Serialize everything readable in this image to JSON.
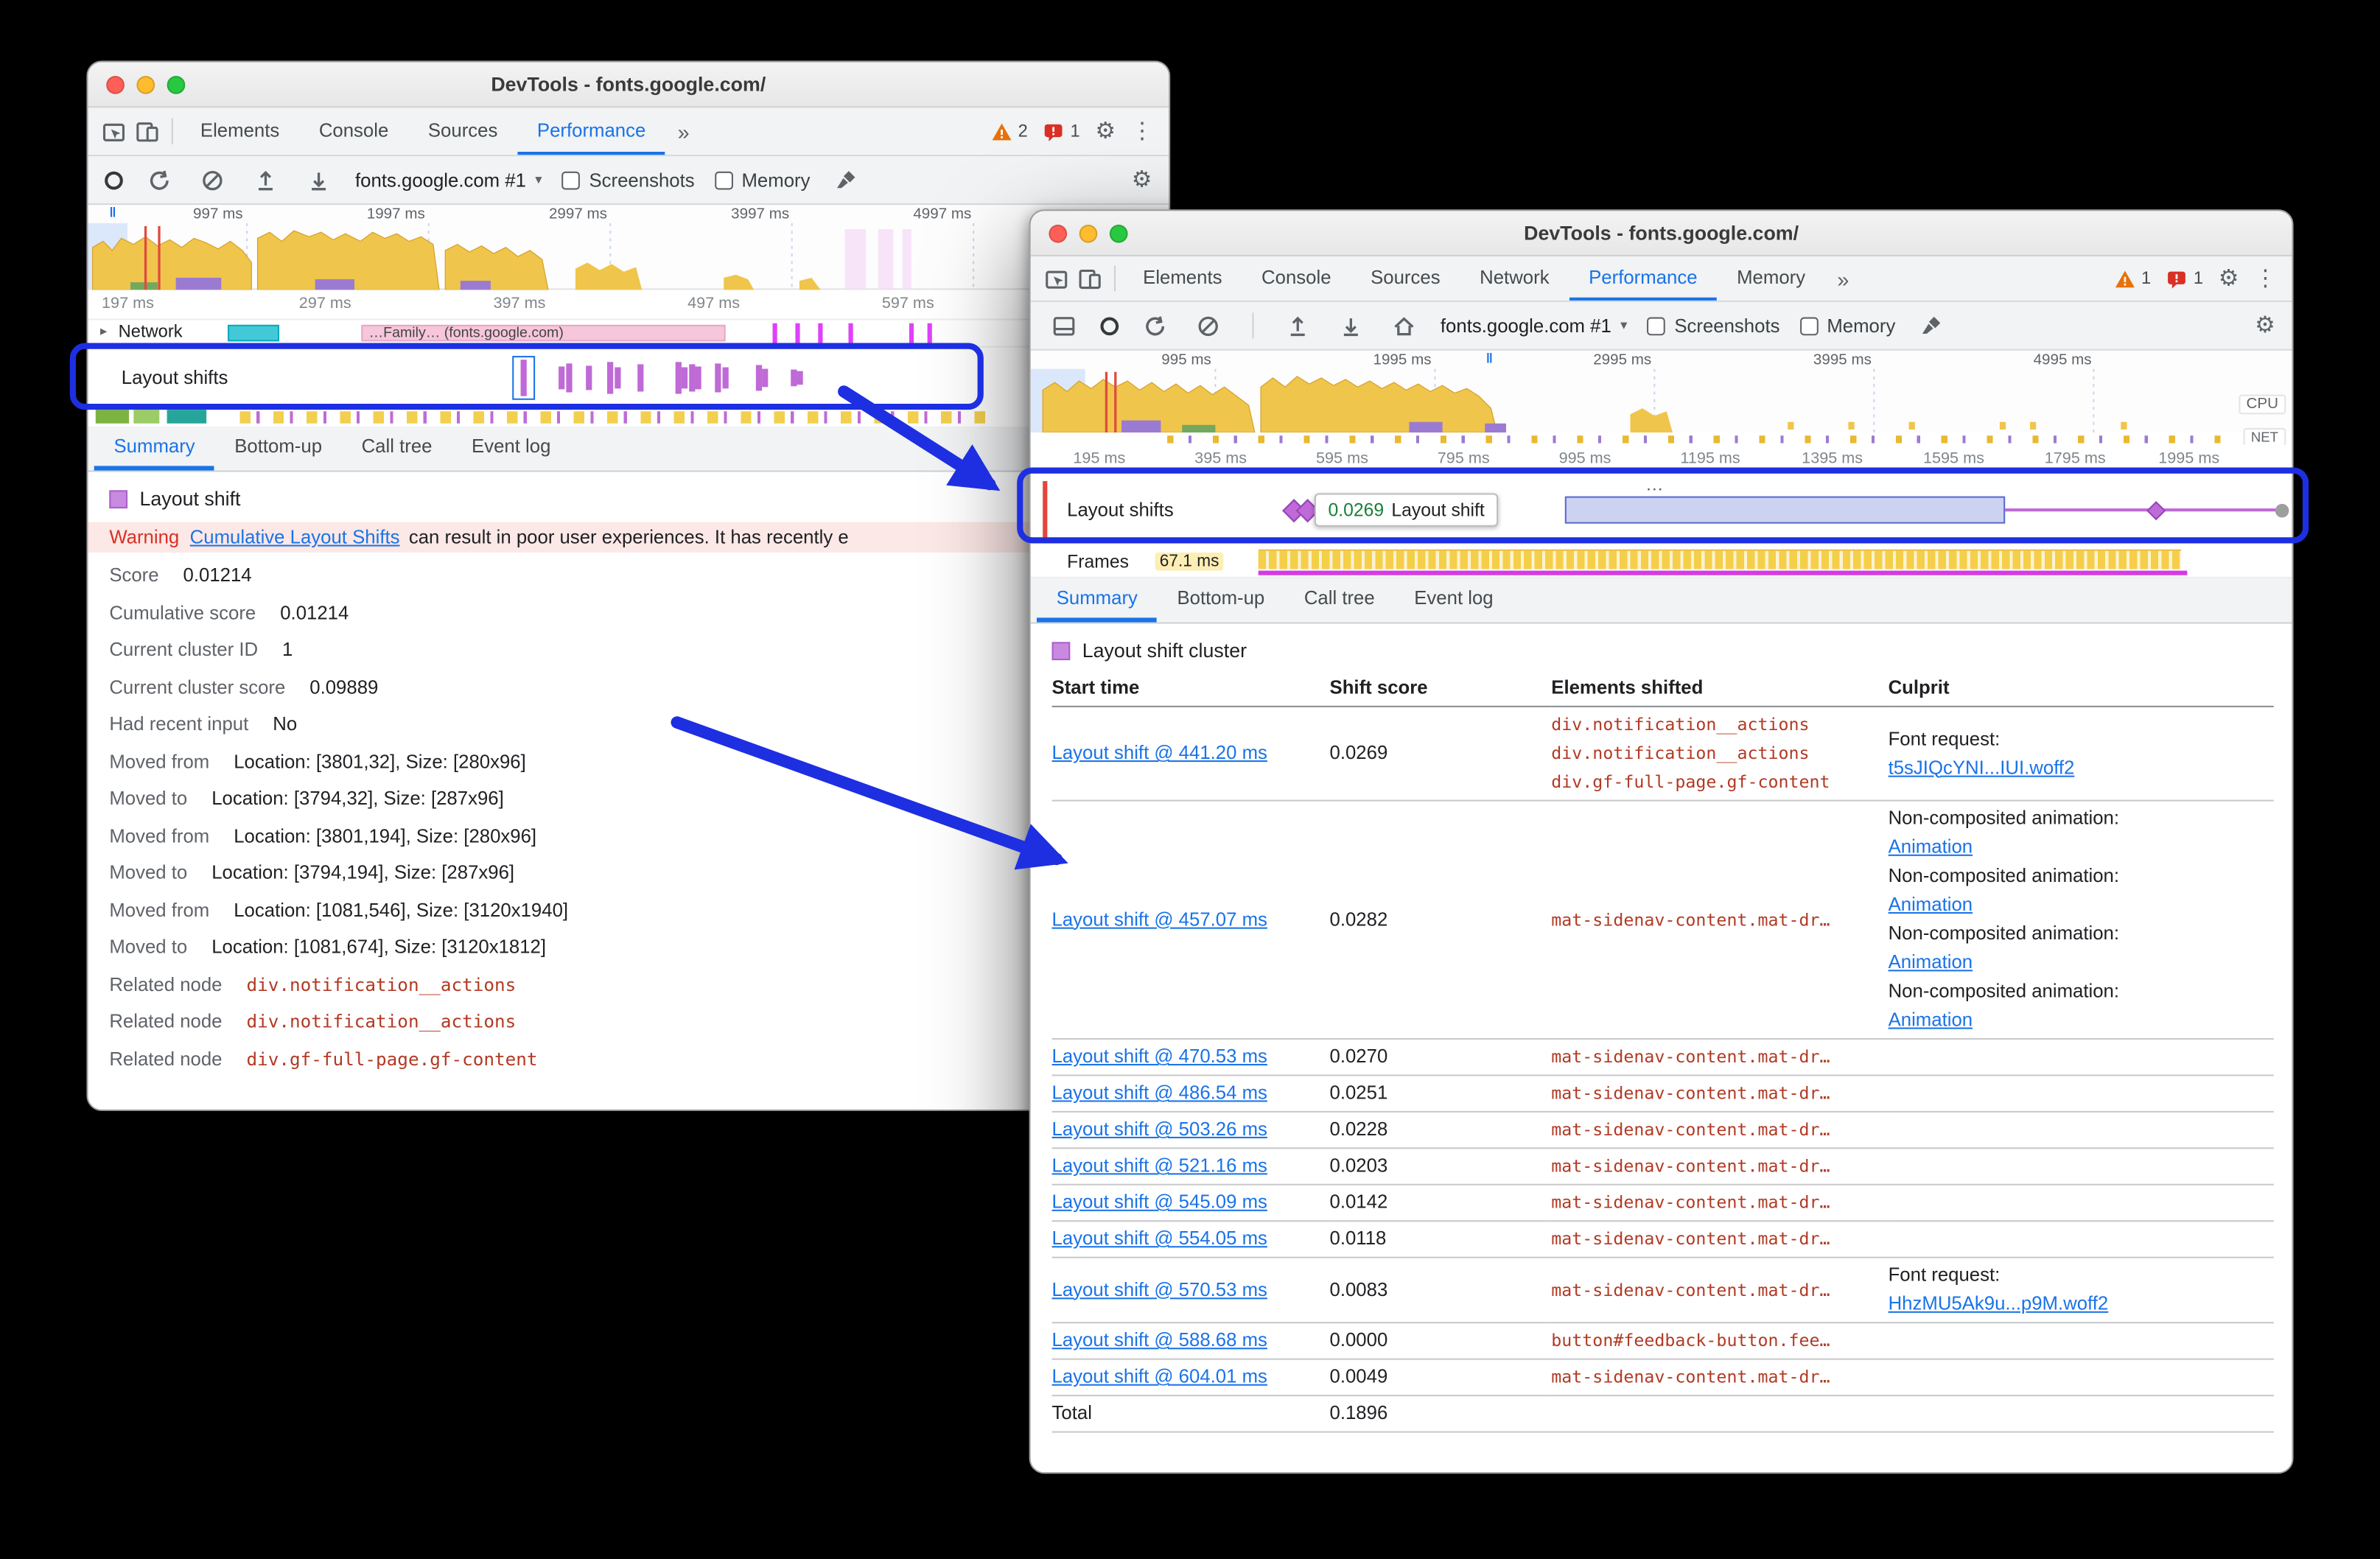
{
  "icons": {
    "gear": "⚙",
    "overflow_menu": "⋮",
    "dropdown_caret": "▾",
    "disclosure_caret": "▸",
    "pause_marker": "‖",
    "more_tabs": "»",
    "ellipsis": "…"
  },
  "window1": {
    "title": "DevTools - fonts.google.com/",
    "nav_tabs": [
      "Elements",
      "Console",
      "Sources",
      "Performance"
    ],
    "active_nav_tab": "Performance",
    "warning_count": "2",
    "error_count": "1",
    "profile_select": "fonts.google.com #1",
    "screenshots_label": "Screenshots",
    "memory_label": "Memory",
    "overview_labels": [
      "997 ms",
      "1997 ms",
      "2997 ms",
      "3997 ms",
      "4997 ms"
    ],
    "ruler_labels": [
      "197 ms",
      "297 ms",
      "397 ms",
      "497 ms",
      "597 ms"
    ],
    "network_track": {
      "label": "Network",
      "request_text": "…Family… (fonts.google.com)"
    },
    "layout_shifts_label": "Layout shifts",
    "panel_tabs": [
      "Summary",
      "Bottom-up",
      "Call tree",
      "Event log"
    ],
    "active_panel_tab": "Summary",
    "summary": {
      "legend_label": "Layout shift",
      "warning": {
        "label": "Warning",
        "link": "Cumulative Layout Shifts",
        "text": "can result in poor user experiences. It has recently e"
      },
      "fields": [
        {
          "label": "Score",
          "value": "0.01214"
        },
        {
          "label": "Cumulative score",
          "value": "0.01214"
        },
        {
          "label": "Current cluster ID",
          "value": "1"
        },
        {
          "label": "Current cluster score",
          "value": "0.09889"
        },
        {
          "label": "Had recent input",
          "value": "No"
        },
        {
          "label": "Moved from",
          "value": "Location: [3801,32], Size: [280x96]"
        },
        {
          "label": "Moved to",
          "value": "Location: [3794,32], Size: [287x96]"
        },
        {
          "label": "Moved from",
          "value": "Location: [3801,194], Size: [280x96]"
        },
        {
          "label": "Moved to",
          "value": "Location: [3794,194], Size: [287x96]"
        },
        {
          "label": "Moved from",
          "value": "Location: [1081,546], Size: [3120x1940]"
        },
        {
          "label": "Moved to",
          "value": "Location: [1081,674], Size: [3120x1812]"
        },
        {
          "label": "Related node",
          "value": "div.notification__actions",
          "kind": "node"
        },
        {
          "label": "Related node",
          "value": "div.notification__actions",
          "kind": "node"
        },
        {
          "label": "Related node",
          "value": "div.gf-full-page.gf-content",
          "kind": "node"
        }
      ]
    }
  },
  "window2": {
    "title": "DevTools - fonts.google.com/",
    "nav_tabs": [
      "Elements",
      "Console",
      "Sources",
      "Network",
      "Performance",
      "Memory"
    ],
    "active_nav_tab": "Performance",
    "warning_count": "1",
    "issues_count": "1",
    "profile_select": "fonts.google.com #1",
    "screenshots_label": "Screenshots",
    "memory_label": "Memory",
    "cpu_label": "CPU",
    "net_label": "NET",
    "overview_labels": [
      "995 ms",
      "1995 ms",
      "2995 ms",
      "3995 ms",
      "4995 ms"
    ],
    "ruler_labels": [
      "195 ms",
      "395 ms",
      "595 ms",
      "795 ms",
      "995 ms",
      "1195 ms",
      "1395 ms",
      "1595 ms",
      "1795 ms",
      "1995 ms"
    ],
    "layout_shifts_label": "Layout shifts",
    "tooltip": {
      "score": "0.0269",
      "label": "Layout shift"
    },
    "frames_track": {
      "label": "Frames",
      "value": "67.1 ms"
    },
    "panel_tabs": [
      "Summary",
      "Bottom-up",
      "Call tree",
      "Event log"
    ],
    "active_panel_tab": "Summary",
    "cluster": {
      "legend_label": "Layout shift cluster",
      "columns": [
        "Start time",
        "Shift score",
        "Elements shifted",
        "Culprit"
      ],
      "rows": [
        {
          "start": "Layout shift @ 441.20 ms",
          "score": "0.0269",
          "elements": [
            "div.notification__actions",
            "div.notification__actions",
            "div.gf-full-page.gf-content"
          ],
          "culprits": [
            {
              "label": "Font request:",
              "link": "t5sJIQcYNI...IUI.woff2"
            }
          ]
        },
        {
          "start": "Layout shift @ 457.07 ms",
          "score": "0.0282",
          "elements": [
            "mat-sidenav-content.mat-dr…"
          ],
          "culprits": [
            {
              "label": "Non-composited animation:",
              "link": "Animation"
            },
            {
              "label": "Non-composited animation:",
              "link": "Animation"
            },
            {
              "label": "Non-composited animation:",
              "link": "Animation"
            },
            {
              "label": "Non-composited animation:",
              "link": "Animation"
            }
          ]
        },
        {
          "start": "Layout shift @ 470.53 ms",
          "score": "0.0270",
          "elements": [
            "mat-sidenav-content.mat-dr…"
          ],
          "culprits": []
        },
        {
          "start": "Layout shift @ 486.54 ms",
          "score": "0.0251",
          "elements": [
            "mat-sidenav-content.mat-dr…"
          ],
          "culprits": []
        },
        {
          "start": "Layout shift @ 503.26 ms",
          "score": "0.0228",
          "elements": [
            "mat-sidenav-content.mat-dr…"
          ],
          "culprits": []
        },
        {
          "start": "Layout shift @ 521.16 ms",
          "score": "0.0203",
          "elements": [
            "mat-sidenav-content.mat-dr…"
          ],
          "culprits": []
        },
        {
          "start": "Layout shift @ 545.09 ms",
          "score": "0.0142",
          "elements": [
            "mat-sidenav-content.mat-dr…"
          ],
          "culprits": []
        },
        {
          "start": "Layout shift @ 554.05 ms",
          "score": "0.0118",
          "elements": [
            "mat-sidenav-content.mat-dr…"
          ],
          "culprits": []
        },
        {
          "start": "Layout shift @ 570.53 ms",
          "score": "0.0083",
          "elements": [
            "mat-sidenav-content.mat-dr…"
          ],
          "culprits": [
            {
              "label": "Font request:",
              "link": "HhzMU5Ak9u...p9M.woff2"
            }
          ]
        },
        {
          "start": "Layout shift @ 588.68 ms",
          "score": "0.0000",
          "elements": [
            "button#feedback-button.fee…"
          ],
          "culprits": []
        },
        {
          "start": "Layout shift @ 604.01 ms",
          "score": "0.0049",
          "elements": [
            "mat-sidenav-content.mat-dr…"
          ],
          "culprits": []
        }
      ],
      "total_label": "Total",
      "total_value": "0.1896"
    }
  }
}
